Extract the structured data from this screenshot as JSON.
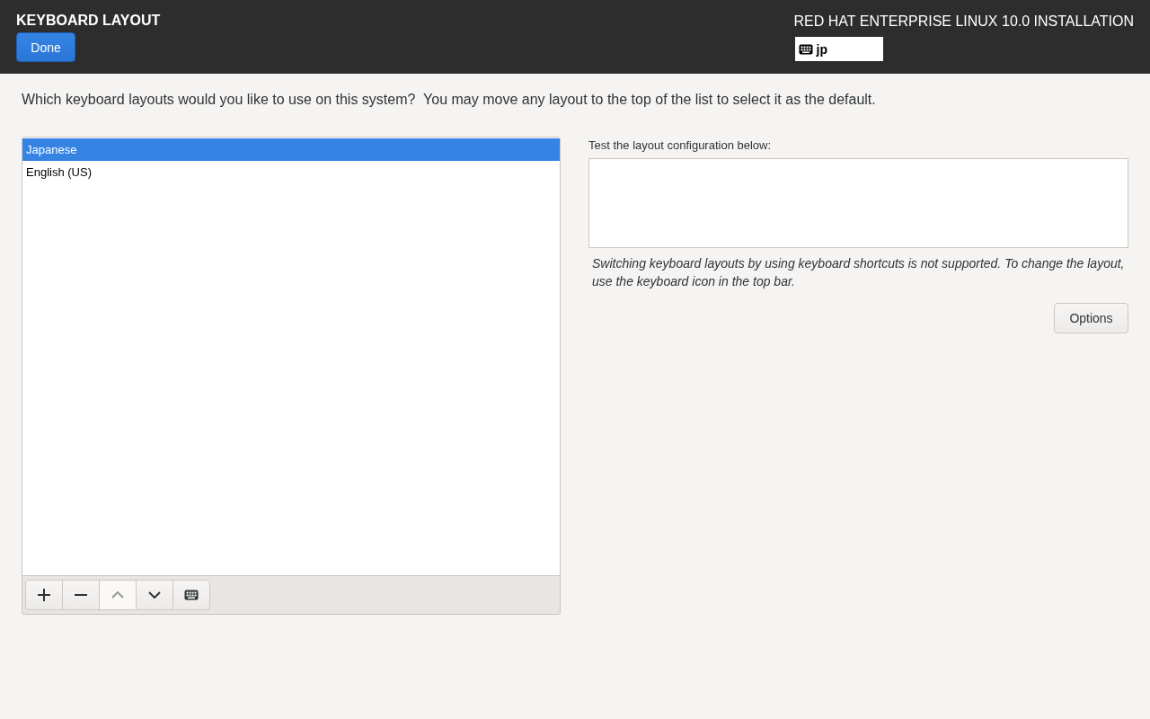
{
  "header": {
    "title": "KEYBOARD LAYOUT",
    "done_button": "Done",
    "product": "RED HAT ENTERPRISE LINUX 10.0 INSTALLATION",
    "layout_indicator": "jp"
  },
  "prompt": "Which keyboard layouts would you like to use on this system?  You may move any layout to the top of the list to select it as the default.",
  "layouts": [
    {
      "name": "Japanese",
      "selected": true
    },
    {
      "name": "English (US)",
      "selected": false
    }
  ],
  "toolbar": [
    {
      "kind": "add",
      "disabled": false
    },
    {
      "kind": "remove",
      "disabled": false
    },
    {
      "kind": "up",
      "disabled": true
    },
    {
      "kind": "down",
      "disabled": false
    },
    {
      "kind": "keyboard",
      "disabled": false
    }
  ],
  "test": {
    "label": "Test the layout configuration below:",
    "note": "Switching keyboard layouts by using keyboard shortcuts is not supported. To change the layout, use the keyboard icon in the top bar.",
    "options_button": "Options"
  }
}
